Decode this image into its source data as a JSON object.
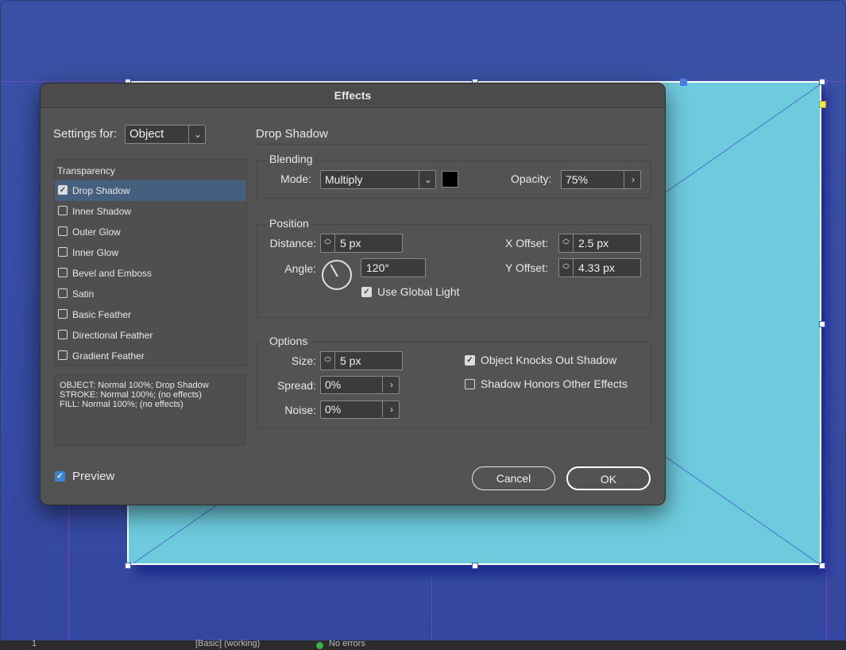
{
  "dialog": {
    "title": "Effects",
    "settings_for_label": "Settings for:",
    "settings_for_value": "Object",
    "section_title": "Drop Shadow",
    "effects_list": {
      "header": "Transparency",
      "items": [
        {
          "label": "Drop Shadow",
          "checked": true,
          "selected": true
        },
        {
          "label": "Inner Shadow",
          "checked": false
        },
        {
          "label": "Outer Glow",
          "checked": false
        },
        {
          "label": "Inner Glow",
          "checked": false
        },
        {
          "label": "Bevel and Emboss",
          "checked": false
        },
        {
          "label": "Satin",
          "checked": false
        },
        {
          "label": "Basic Feather",
          "checked": false
        },
        {
          "label": "Directional Feather",
          "checked": false
        },
        {
          "label": "Gradient Feather",
          "checked": false
        }
      ]
    },
    "summary": {
      "line1": "OBJECT: Normal 100%; Drop Shadow",
      "line2": "STROKE: Normal 100%; (no effects)",
      "line3": "FILL: Normal 100%; (no effects)"
    },
    "blending": {
      "title": "Blending",
      "mode_label": "Mode:",
      "mode_value": "Multiply",
      "color": "#000000",
      "opacity_label": "Opacity:",
      "opacity_value": "75%"
    },
    "position": {
      "title": "Position",
      "distance_label": "Distance:",
      "distance_value": "5 px",
      "angle_label": "Angle:",
      "angle_value": "120°",
      "use_global_light_label": "Use Global Light",
      "use_global_light": true,
      "x_offset_label": "X Offset:",
      "x_offset_value": "2.5 px",
      "y_offset_label": "Y Offset:",
      "y_offset_value": "4.33 px"
    },
    "options": {
      "title": "Options",
      "size_label": "Size:",
      "size_value": "5 px",
      "spread_label": "Spread:",
      "spread_value": "0%",
      "noise_label": "Noise:",
      "noise_value": "0%",
      "knocks_out_label": "Object Knocks Out Shadow",
      "knocks_out": true,
      "honors_label": "Shadow Honors Other Effects",
      "honors": false
    },
    "preview_label": "Preview",
    "preview": true,
    "cancel_label": "Cancel",
    "ok_label": "OK"
  },
  "status_bar": {
    "page": "1",
    "preflight_profile": "[Basic] (working)",
    "errors": "No errors"
  },
  "colors": {
    "canvas": "#3a52a6",
    "object_fill": "#6dcbdd",
    "dialog_bg": "#535353",
    "selection": "#45607e",
    "accent": "#3a86d4"
  }
}
